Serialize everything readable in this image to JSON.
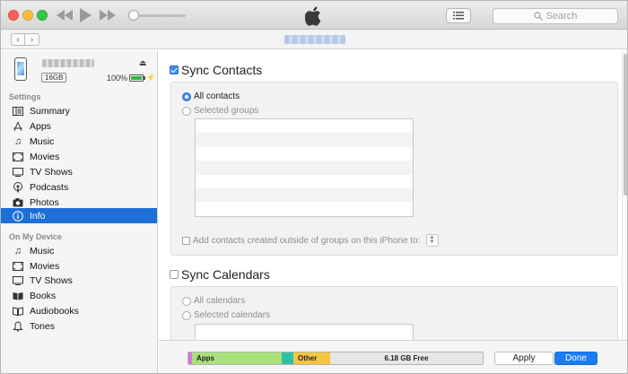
{
  "toolbar": {
    "search_placeholder": "Search"
  },
  "device": {
    "capacity": "16GB",
    "battery_percent": "100%",
    "battery_level": 1.0
  },
  "sidebar": {
    "settings_header": "Settings",
    "settings_items": [
      {
        "label": "Summary",
        "icon": "summary-icon"
      },
      {
        "label": "Apps",
        "icon": "apps-icon"
      },
      {
        "label": "Music",
        "icon": "music-icon"
      },
      {
        "label": "Movies",
        "icon": "movies-icon"
      },
      {
        "label": "TV Shows",
        "icon": "tv-shows-icon"
      },
      {
        "label": "Podcasts",
        "icon": "podcasts-icon"
      },
      {
        "label": "Photos",
        "icon": "photos-icon"
      },
      {
        "label": "Info",
        "icon": "info-icon",
        "selected": true
      }
    ],
    "device_header": "On My Device",
    "device_items": [
      {
        "label": "Music",
        "icon": "music-icon"
      },
      {
        "label": "Movies",
        "icon": "movies-icon"
      },
      {
        "label": "TV Shows",
        "icon": "tv-shows-icon"
      },
      {
        "label": "Books",
        "icon": "books-icon"
      },
      {
        "label": "Audiobooks",
        "icon": "audiobooks-icon"
      },
      {
        "label": "Tones",
        "icon": "tones-icon"
      }
    ]
  },
  "contacts": {
    "title": "Sync Contacts",
    "checked": true,
    "all_label": "All contacts",
    "selected_label": "Selected groups",
    "add_outside_label": "Add contacts created outside of groups on this iPhone to:"
  },
  "calendars": {
    "title": "Sync Calendars",
    "checked": false,
    "all_label": "All calendars",
    "selected_label": "Selected calendars"
  },
  "storage": {
    "apps_label": "Apps",
    "other_label": "Other",
    "free_label": "6.18 GB Free",
    "colors": {
      "audio": "#d678d6",
      "apps": "#a8e07a",
      "books": "#2cc1a4",
      "other": "#f5c542",
      "free": "#e6e6e6"
    }
  },
  "buttons": {
    "apply": "Apply",
    "done": "Done"
  },
  "colors": {
    "selection": "#1f6fd8",
    "primary_button": "#1b7cf5"
  }
}
